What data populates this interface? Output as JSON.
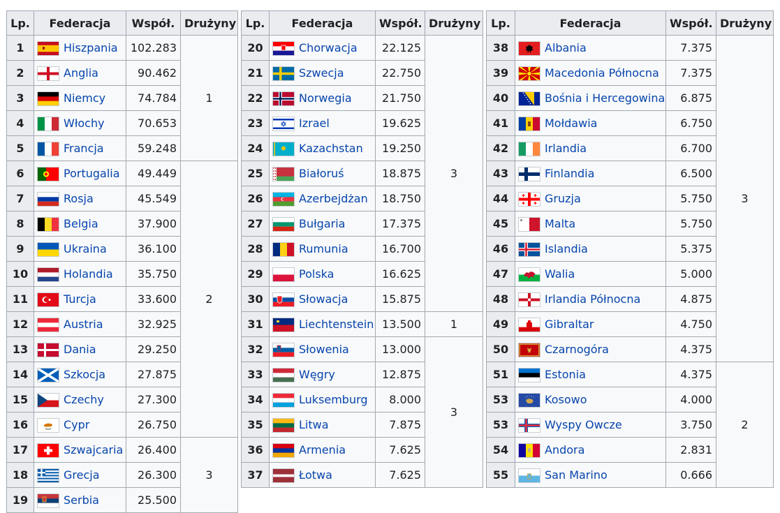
{
  "headers": {
    "lp": "Lp.",
    "fed": "Federacja",
    "coef": "Współ.",
    "teams": "Drużyny"
  },
  "tables": [
    {
      "rows": [
        {
          "lp": "1",
          "name": "Hiszpania",
          "coef": "102.283",
          "flag": "spain-flag-icon"
        },
        {
          "lp": "2",
          "name": "Anglia",
          "coef": "90.462",
          "flag": "england-flag-icon"
        },
        {
          "lp": "3",
          "name": "Niemcy",
          "coef": "74.784",
          "flag": "germany-flag-icon"
        },
        {
          "lp": "4",
          "name": "Włochy",
          "coef": "70.653",
          "flag": "italy-flag-icon"
        },
        {
          "lp": "5",
          "name": "Francja",
          "coef": "59.248",
          "flag": "france-flag-icon"
        },
        {
          "lp": "6",
          "name": "Portugalia",
          "coef": "49.449",
          "flag": "portugal-flag-icon"
        },
        {
          "lp": "7",
          "name": "Rosja",
          "coef": "45.549",
          "flag": "russia-flag-icon"
        },
        {
          "lp": "8",
          "name": "Belgia",
          "coef": "37.900",
          "flag": "belgium-flag-icon"
        },
        {
          "lp": "9",
          "name": "Ukraina",
          "coef": "36.100",
          "flag": "ukraine-flag-icon"
        },
        {
          "lp": "10",
          "name": "Holandia",
          "coef": "35.750",
          "flag": "netherlands-flag-icon"
        },
        {
          "lp": "11",
          "name": "Turcja",
          "coef": "33.600",
          "flag": "turkey-flag-icon"
        },
        {
          "lp": "12",
          "name": "Austria",
          "coef": "32.925",
          "flag": "austria-flag-icon"
        },
        {
          "lp": "13",
          "name": "Dania",
          "coef": "29.250",
          "flag": "denmark-flag-icon"
        },
        {
          "lp": "14",
          "name": "Szkocja",
          "coef": "27.875",
          "flag": "scotland-flag-icon"
        },
        {
          "lp": "15",
          "name": "Czechy",
          "coef": "27.300",
          "flag": "czechia-flag-icon"
        },
        {
          "lp": "16",
          "name": "Cypr",
          "coef": "26.750",
          "flag": "cyprus-flag-icon"
        },
        {
          "lp": "17",
          "name": "Szwajcaria",
          "coef": "26.400",
          "flag": "switzerland-flag-icon"
        },
        {
          "lp": "18",
          "name": "Grecja",
          "coef": "26.300",
          "flag": "greece-flag-icon"
        },
        {
          "lp": "19",
          "name": "Serbia",
          "coef": "25.500",
          "flag": "serbia-flag-icon"
        }
      ],
      "groups": [
        {
          "start": 0,
          "span": 5,
          "teams": "1"
        },
        {
          "start": 5,
          "span": 11,
          "teams": "2"
        },
        {
          "start": 16,
          "span": 3,
          "teams": "3"
        }
      ]
    },
    {
      "rows": [
        {
          "lp": "20",
          "name": "Chorwacja",
          "coef": "22.125",
          "flag": "croatia-flag-icon"
        },
        {
          "lp": "21",
          "name": "Szwecja",
          "coef": "22.750",
          "flag": "sweden-flag-icon"
        },
        {
          "lp": "22",
          "name": "Norwegia",
          "coef": "21.750",
          "flag": "norway-flag-icon"
        },
        {
          "lp": "23",
          "name": "Izrael",
          "coef": "19.625",
          "flag": "israel-flag-icon"
        },
        {
          "lp": "24",
          "name": "Kazachstan",
          "coef": "19.250",
          "flag": "kazakhstan-flag-icon"
        },
        {
          "lp": "25",
          "name": "Białoruś",
          "coef": "18.875",
          "flag": "belarus-flag-icon"
        },
        {
          "lp": "26",
          "name": "Azerbejdżan",
          "coef": "18.750",
          "flag": "azerbaijan-flag-icon"
        },
        {
          "lp": "27",
          "name": "Bułgaria",
          "coef": "17.375",
          "flag": "bulgaria-flag-icon"
        },
        {
          "lp": "28",
          "name": "Rumunia",
          "coef": "16.700",
          "flag": "romania-flag-icon"
        },
        {
          "lp": "29",
          "name": "Polska",
          "coef": "16.625",
          "flag": "poland-flag-icon"
        },
        {
          "lp": "30",
          "name": "Słowacja",
          "coef": "15.875",
          "flag": "slovakia-flag-icon"
        },
        {
          "lp": "31",
          "name": "Liechtenstein",
          "coef": "13.500",
          "flag": "liechtenstein-flag-icon"
        },
        {
          "lp": "32",
          "name": "Słowenia",
          "coef": "13.000",
          "flag": "slovenia-flag-icon"
        },
        {
          "lp": "33",
          "name": "Węgry",
          "coef": "12.875",
          "flag": "hungary-flag-icon"
        },
        {
          "lp": "34",
          "name": "Luksemburg",
          "coef": "8.000",
          "flag": "luxembourg-flag-icon"
        },
        {
          "lp": "35",
          "name": "Litwa",
          "coef": "7.875",
          "flag": "lithuania-flag-icon"
        },
        {
          "lp": "36",
          "name": "Armenia",
          "coef": "7.625",
          "flag": "armenia-flag-icon"
        },
        {
          "lp": "37",
          "name": "Łotwa",
          "coef": "7.625",
          "flag": "latvia-flag-icon"
        }
      ],
      "groups": [
        {
          "start": 0,
          "span": 11,
          "teams": "3"
        },
        {
          "start": 11,
          "span": 1,
          "teams": "1"
        },
        {
          "start": 12,
          "span": 6,
          "teams": "3"
        }
      ]
    },
    {
      "rows": [
        {
          "lp": "38",
          "name": "Albania",
          "coef": "7.375",
          "flag": "albania-flag-icon"
        },
        {
          "lp": "39",
          "name": "Macedonia Północna",
          "coef": "7.375",
          "flag": "north-macedonia-flag-icon"
        },
        {
          "lp": "40",
          "name": "Bośnia i Hercegowina",
          "coef": "6.875",
          "flag": "bosnia-flag-icon"
        },
        {
          "lp": "41",
          "name": "Mołdawia",
          "coef": "6.750",
          "flag": "moldova-flag-icon"
        },
        {
          "lp": "42",
          "name": "Irlandia",
          "coef": "6.700",
          "flag": "ireland-flag-icon"
        },
        {
          "lp": "43",
          "name": "Finlandia",
          "coef": "6.500",
          "flag": "finland-flag-icon"
        },
        {
          "lp": "44",
          "name": "Gruzja",
          "coef": "5.750",
          "flag": "georgia-flag-icon"
        },
        {
          "lp": "45",
          "name": "Malta",
          "coef": "5.750",
          "flag": "malta-flag-icon"
        },
        {
          "lp": "46",
          "name": "Islandia",
          "coef": "5.375",
          "flag": "iceland-flag-icon"
        },
        {
          "lp": "47",
          "name": "Walia",
          "coef": "5.000",
          "flag": "wales-flag-icon"
        },
        {
          "lp": "48",
          "name": "Irlandia Północna",
          "coef": "4.875",
          "flag": "northern-ireland-flag-icon"
        },
        {
          "lp": "49",
          "name": "Gibraltar",
          "coef": "4.750",
          "flag": "gibraltar-flag-icon"
        },
        {
          "lp": "50",
          "name": "Czarnogóra",
          "coef": "4.375",
          "flag": "montenegro-flag-icon"
        },
        {
          "lp": "51",
          "name": "Estonia",
          "coef": "4.375",
          "flag": "estonia-flag-icon"
        },
        {
          "lp": "53",
          "name": "Kosowo",
          "coef": "4.000",
          "flag": "kosovo-flag-icon"
        },
        {
          "lp": "53",
          "name": "Wyspy Owcze",
          "coef": "3.750",
          "flag": "faroe-flag-icon"
        },
        {
          "lp": "54",
          "name": "Andora",
          "coef": "2.831",
          "flag": "andorra-flag-icon"
        },
        {
          "lp": "55",
          "name": "San Marino",
          "coef": "0.666",
          "flag": "san-marino-flag-icon"
        }
      ],
      "groups": [
        {
          "start": 0,
          "span": 13,
          "teams": "3"
        },
        {
          "start": 13,
          "span": 5,
          "teams": "2"
        }
      ]
    }
  ]
}
